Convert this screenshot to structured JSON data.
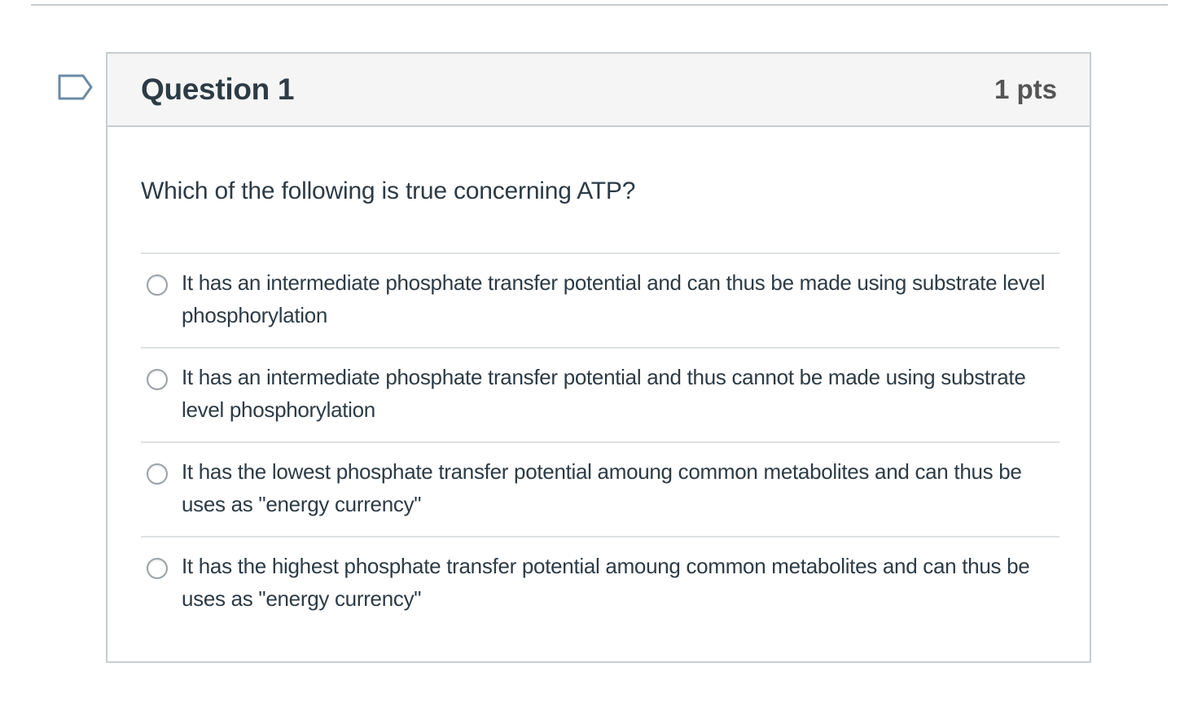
{
  "question": {
    "title": "Question 1",
    "points": "1 pts",
    "text": "Which of the following is true concerning ATP?",
    "answers": [
      {
        "label": "It has an intermediate phosphate transfer potential and can thus be made using substrate level phosphorylation"
      },
      {
        "label": "It has an intermediate phosphate transfer potential and thus cannot be made using substrate level phosphorylation"
      },
      {
        "label": "It has the lowest phosphate transfer potential amoung common metabolites and can thus be uses as \"energy currency\""
      },
      {
        "label": "It has the highest phosphate transfer potential amoung common metabolites and can thus be uses as \"energy currency\""
      }
    ]
  },
  "icons": {
    "flag": "flag-outline-icon"
  },
  "colors": {
    "text": "#2d3b45",
    "header_bg": "#f5f5f5",
    "border": "#c7cdd1",
    "flag": "#6b8ba4"
  }
}
